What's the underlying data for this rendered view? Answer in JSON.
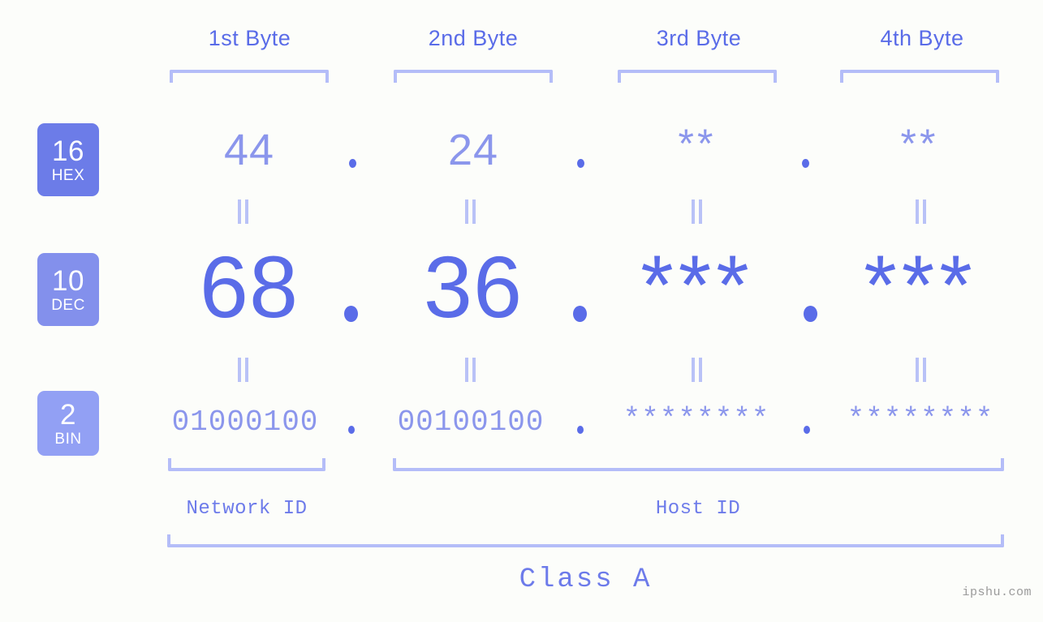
{
  "background_color": "#fcfdfa",
  "accent_strong": "#5a6ce8",
  "accent_mid": "#8b96ec",
  "accent_light": "#b4bdf8",
  "byte_headers": [
    {
      "label": "1st Byte"
    },
    {
      "label": "2nd Byte"
    },
    {
      "label": "3rd Byte"
    },
    {
      "label": "4th Byte"
    }
  ],
  "rows": [
    {
      "radix": "16",
      "radix_name": "HEX",
      "badge_color": "#6c7ce8",
      "values": [
        "44",
        "24",
        "**",
        "**"
      ]
    },
    {
      "radix": "10",
      "radix_name": "DEC",
      "badge_color": "#8390ec",
      "values": [
        "68",
        "36",
        "***",
        "***"
      ]
    },
    {
      "radix": "2",
      "radix_name": "BIN",
      "badge_color": "#92a0f4",
      "values": [
        "01000100",
        "00100100",
        "********",
        "********"
      ]
    }
  ],
  "separator": ".",
  "equals_symbol": "=",
  "segments": {
    "network_id": "Network ID",
    "host_id": "Host ID"
  },
  "class_label": "Class A",
  "watermark": "ipshu.com"
}
